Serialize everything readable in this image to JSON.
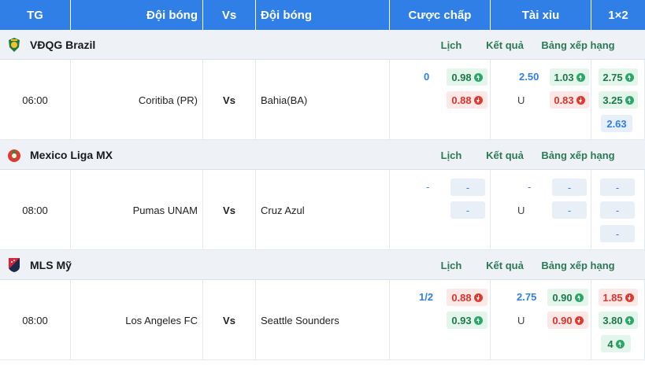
{
  "header": {
    "time": "TG",
    "home": "Đội bóng",
    "vs": "Vs",
    "away": "Đội bóng",
    "handicap": "Cược chấp",
    "overunder": "Tài xỉu",
    "onextwo": "1×2"
  },
  "league_links": {
    "schedule": "Lịch",
    "results": "Kết quả",
    "standings": "Bảng xếp hạng"
  },
  "leagues": [
    {
      "name": "VĐQG Brazil",
      "logo_icon": "brazil-league-icon",
      "match": {
        "time": "06:00",
        "home": "Coritiba (PR)",
        "vs": "Vs",
        "away": "Bahia(BA)",
        "hc_line": "0",
        "hc_home": "0.98",
        "hc_away": "0.88",
        "ou_line": "2.50",
        "ou_under_label": "U",
        "ou_over": "1.03",
        "ou_under": "0.83",
        "x1": "2.75",
        "x2": "3.25",
        "x3": "2.63"
      }
    },
    {
      "name": "Mexico Liga MX",
      "logo_icon": "liga-mx-icon",
      "match": {
        "time": "08:00",
        "home": "Pumas UNAM",
        "vs": "Vs",
        "away": "Cruz Azul",
        "hc_line": "-",
        "hc_home": "-",
        "hc_away": "-",
        "ou_line": "-",
        "ou_under_label": "U",
        "ou_over": "-",
        "ou_under": "-",
        "x1": "-",
        "x2": "-",
        "x3": "-"
      }
    },
    {
      "name": "MLS Mỹ",
      "logo_icon": "mls-icon",
      "match": {
        "time": "08:00",
        "home": "Los Angeles FC",
        "vs": "Vs",
        "away": "Seattle Sounders",
        "hc_line": "1/2",
        "hc_home": "0.88",
        "hc_away": "0.93",
        "ou_line": "2.75",
        "ou_under_label": "U",
        "ou_over": "0.90",
        "ou_under": "0.90",
        "x1": "1.85",
        "x2": "3.80",
        "x3": "4"
      }
    }
  ],
  "colors": {
    "header_bg": "#2f7fe6",
    "up": "#2aa866",
    "down": "#e0392f",
    "link": "#2b7a55"
  }
}
